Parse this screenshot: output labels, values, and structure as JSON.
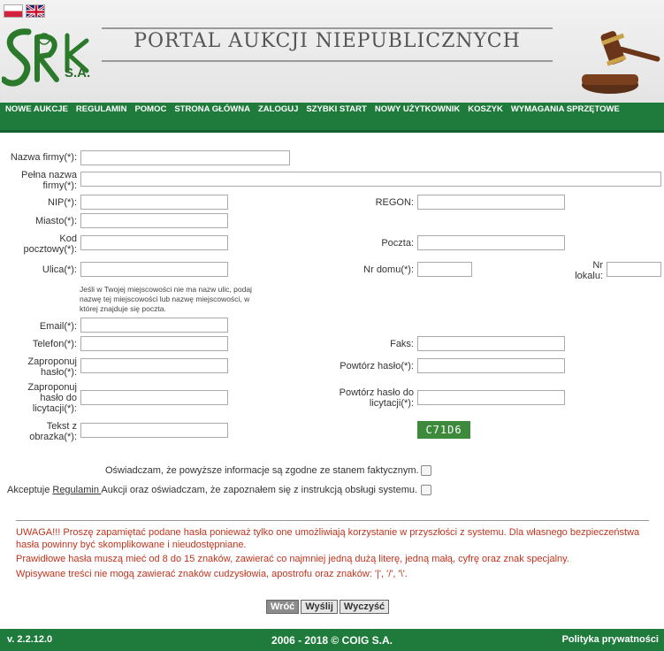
{
  "header": {
    "title": "PORTAL AUKCJI NIEPUBLICZNYCH",
    "logo_text": "SRK",
    "logo_sub": "S.A.",
    "flags": [
      "flag-pl-icon",
      "flag-gb-icon"
    ]
  },
  "nav": {
    "items": [
      "NOWE AUKCJE",
      "REGULAMIN",
      "POMOC",
      "STRONA GŁÓWNA",
      "ZALOGUJ",
      "SZYBKI START",
      "NOWY UŻYTKOWNIK",
      "KOSZYK",
      "WYMAGANIA SPRZĘTOWE"
    ]
  },
  "form": {
    "company_name": "Nazwa firmy(*):",
    "full_name_1": "Pełna nazwa",
    "full_name_2": "firmy(*):",
    "nip": "NIP(*):",
    "regon": "REGON:",
    "city": "Miasto(*):",
    "postal_code_1": "Kod",
    "postal_code_2": "pocztowy(*):",
    "post_office": "Poczta:",
    "street": "Ulica(*):",
    "house_no": "Nr domu(*):",
    "flat_no_1": "Nr",
    "flat_no_2": "lokalu:",
    "street_hint": "Jeśli w Twojej miejscowości nie ma nazw ulic, podaj nazwę tej miejscowości lub nazwę miejscowości, w której znajduje się poczta.",
    "email": "Email(*):",
    "phone": "Telefon(*):",
    "fax": "Faks:",
    "password_1": "Zaproponuj",
    "password_2": "hasło(*):",
    "password_repeat": "Powtórz hasło(*):",
    "bid_password_1": "Zaproponuj",
    "bid_password_2": "hasło do",
    "bid_password_3": "licytacji(*):",
    "bid_password_repeat_1": "Powtórz hasło do",
    "bid_password_repeat_2": "licytacji(*):",
    "captcha_label_1": "Tekst z",
    "captcha_label_2": "obrazka(*):",
    "captcha_text": "C71D6"
  },
  "declarations": {
    "truth": "Oświadczam, że powyższe informacje są zgodne ze stanem faktycznym.",
    "terms_pre": "Akceptuje ",
    "terms_link": "Regulamin ",
    "terms_post": "Aukcji oraz oświadczam, że zapoznałem się z instrukcją obsługi systemu."
  },
  "warnings": {
    "w1": "UWAGA!!! Proszę zapamiętać podane hasła ponieważ tylko one umożliwiają korzystanie w przyszłości z systemu. Dla własnego bezpieczeństwa hasła powinny być skomplikowane i nieudostępniane.",
    "w2": "Prawidłowe hasła muszą mieć od 8 do 15 znaków, zawierać co najmniej jedną dużą literę, jedną małą, cyfrę oraz znak specjalny.",
    "w3": "Wpisywane treści nie mogą zawierać znaków cudzysłowia, apostrofu oraz znaków: '|', '/', '\\'."
  },
  "buttons": {
    "back": "Wróć",
    "send": "Wyślij",
    "clear": "Wyczyść"
  },
  "footer": {
    "version": "v. 2.2.12.0",
    "copyright": "2006 - 2018 © COIG S.A.",
    "privacy": "Polityka prywatności"
  },
  "colors": {
    "brand_green": "#1e7b3c",
    "warning_red": "#c0341d",
    "captcha_bg": "#3d8a3d"
  }
}
